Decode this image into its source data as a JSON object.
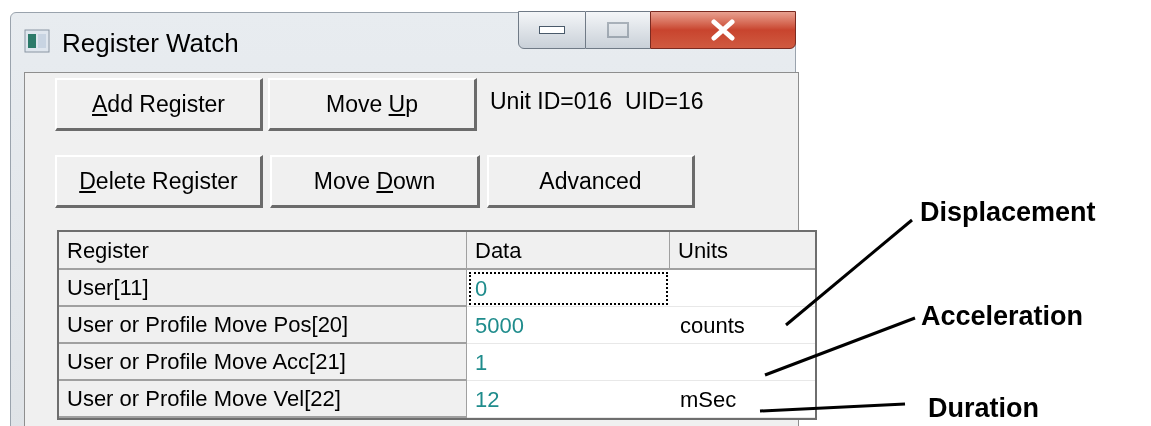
{
  "window": {
    "title": "Register Watch",
    "controls": [
      {
        "kind": "minimize",
        "disabled": false
      },
      {
        "kind": "maximize",
        "disabled": true
      },
      {
        "kind": "close",
        "disabled": false
      }
    ]
  },
  "button_rows": [
    [
      {
        "parts": [
          {
            "text": "A",
            "underlined": true
          },
          {
            "text": "dd Register",
            "underlined": false
          }
        ]
      },
      {
        "parts": [
          {
            "text": "Move ",
            "underlined": false
          },
          {
            "text": "U",
            "underlined": true
          },
          {
            "text": "p",
            "underlined": false
          }
        ]
      }
    ],
    [
      {
        "parts": [
          {
            "text": "D",
            "underlined": true
          },
          {
            "text": "elete Register",
            "underlined": false
          }
        ]
      },
      {
        "parts": [
          {
            "text": "Move ",
            "underlined": false
          },
          {
            "text": "D",
            "underlined": true
          },
          {
            "text": "own",
            "underlined": false
          }
        ]
      },
      {
        "parts": [
          {
            "text": "Advanced",
            "underlined": false
          }
        ]
      }
    ]
  ],
  "unit_info": "Unit ID=016  UID=16",
  "table": {
    "columns": [
      "Register",
      "Data",
      "Units"
    ],
    "rows": [
      {
        "register": "User[11]",
        "data": "0",
        "focused": true
      },
      {
        "register": "User or Profile Move Pos[20]",
        "data": "5000",
        "units": "counts",
        "focused": false
      },
      {
        "register": "User or Profile Move Acc[21]",
        "data": "1",
        "focused": false
      },
      {
        "register": "User or Profile Move Vel[22]",
        "data": "12",
        "units": "mSec",
        "focused": false
      }
    ]
  },
  "annotations": [
    {
      "label": "Displacement"
    },
    {
      "label": "Acceleration"
    },
    {
      "label": "Duration"
    }
  ]
}
